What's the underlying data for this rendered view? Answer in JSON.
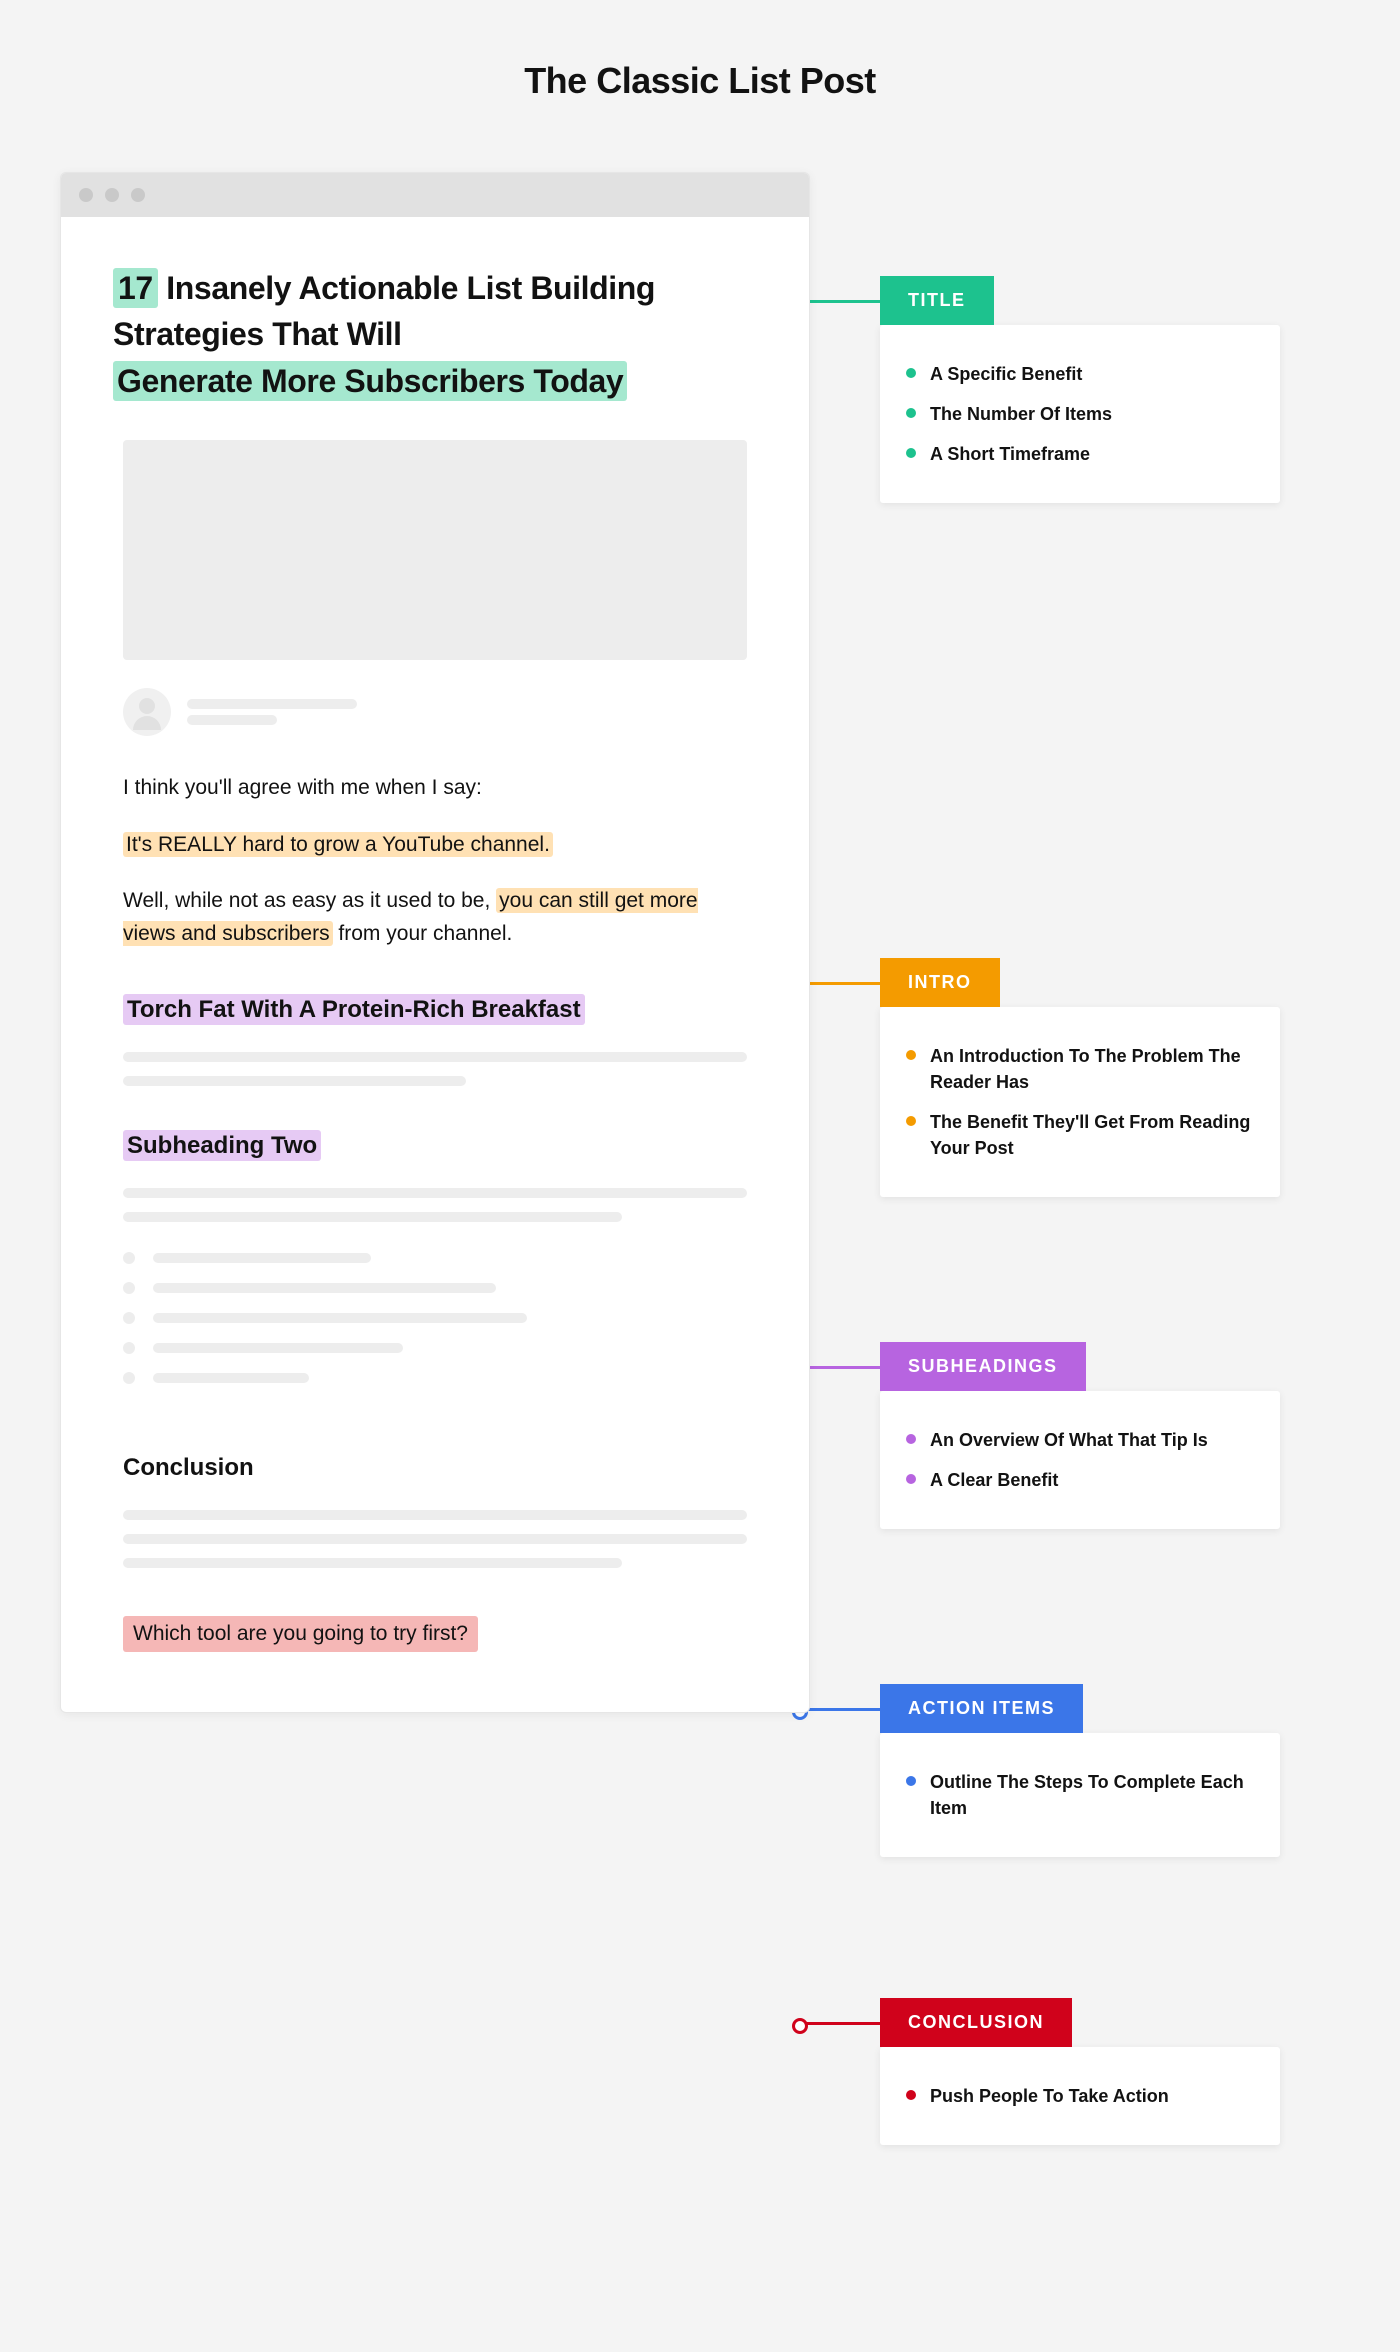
{
  "page": {
    "title": "The Classic List Post"
  },
  "post": {
    "title_number": "17",
    "title_middle": "Insanely Actionable List Building Strategies That Will",
    "title_highlight": "Generate More Subscribers Today",
    "intro": {
      "line1": "I think you'll agree with me when I say:",
      "hl1": "It's REALLY hard to grow a YouTube channel.",
      "line3_a": "Well, while not as easy as it used to be, ",
      "line3_hl": "you can still get more views and subscribers",
      "line3_b": " from your channel."
    },
    "sub1": "Torch Fat With A Protein-Rich Breakfast",
    "sub2": "Subheading Two",
    "conclusion_heading": "Conclusion",
    "cta": "Which tool are you going to try first?"
  },
  "callouts": {
    "title": {
      "label": "TITLE",
      "color": "green",
      "items": [
        "A Specific Benefit",
        "The Number Of Items",
        "A Short Timeframe"
      ]
    },
    "intro": {
      "label": "INTRO",
      "color": "orange",
      "items": [
        "An Introduction To The Problem The Reader Has",
        "The Benefit They'll Get From Reading Your Post"
      ]
    },
    "subheading": {
      "label": "SUBHEADINGS",
      "color": "purple",
      "items": [
        "An Overview Of What That Tip Is",
        "A Clear Benefit"
      ]
    },
    "action": {
      "label": "ACTION ITEMS",
      "color": "blue",
      "items": [
        "Outline The Steps To Complete Each Item"
      ]
    },
    "conclusion": {
      "label": "CONCLUSION",
      "color": "red",
      "items": [
        "Push People To Take Action"
      ]
    }
  }
}
